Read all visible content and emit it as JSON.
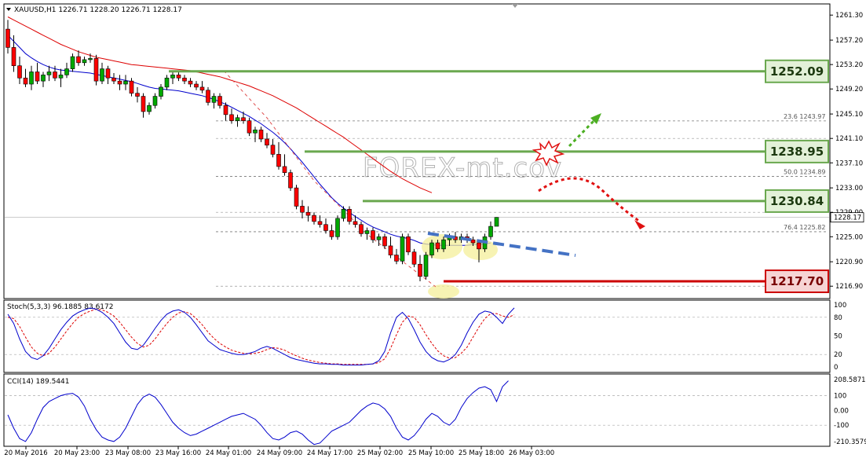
{
  "header": {
    "symbol_line": "XAUUSD,H1  1226.71 1228.20 1226.71 1228.17",
    "stoch_label": "Stoch(5,3,3) 96.1885 83.6172",
    "cci_label": "CCI(14) 189.5441"
  },
  "watermark": "FOREX-mt.cov",
  "colors": {
    "bull": "#00a800",
    "bear": "#ff0000",
    "wick": "#000000",
    "ma_fast": "#0000cc",
    "ma_slow": "#dd0000",
    "resistance": "#6aa84f",
    "support": "#cc0000",
    "trend": "#4472c4",
    "highlight": "#f4ef9a"
  },
  "chart_data": [
    {
      "type": "candlestick",
      "symbol": "XAUUSD",
      "timeframe": "H1",
      "ohlc_last": {
        "open": 1226.71,
        "high": 1228.2,
        "low": 1226.71,
        "close": 1228.17
      },
      "last_price": "1228.17",
      "ylim": [
        1215.0,
        1263.0
      ],
      "y_ticks": [
        "1261.30",
        "1257.20",
        "1253.20",
        "1249.20",
        "1245.10",
        "1241.10",
        "1237.10",
        "1233.00",
        "1229.00",
        "1225.00",
        "1220.90",
        "1216.90"
      ],
      "x_ticks": [
        "20 May 2016",
        "20 May 23:00",
        "23 May 08:00",
        "23 May 16:00",
        "24 May 01:00",
        "24 May 09:00",
        "24 May 17:00",
        "25 May 02:00",
        "25 May 10:00",
        "25 May 18:00",
        "26 May 03:00"
      ],
      "candles": [
        [
          1259.0,
          1260.5,
          1255.0,
          1256.0
        ],
        [
          1256.0,
          1258.0,
          1252.0,
          1253.0
        ],
        [
          1253.0,
          1254.5,
          1250.0,
          1251.0
        ],
        [
          1251.0,
          1252.5,
          1249.5,
          1250.0
        ],
        [
          1250.0,
          1253.0,
          1249.0,
          1252.0
        ],
        [
          1252.0,
          1253.5,
          1250.0,
          1250.5
        ],
        [
          1250.5,
          1252.0,
          1249.5,
          1251.5
        ],
        [
          1251.5,
          1253.0,
          1250.5,
          1252.0
        ],
        [
          1252.0,
          1253.0,
          1250.5,
          1251.0
        ],
        [
          1251.0,
          1252.5,
          1249.5,
          1251.5
        ],
        [
          1251.5,
          1253.5,
          1251.0,
          1252.5
        ],
        [
          1252.5,
          1255.0,
          1252.0,
          1254.5
        ],
        [
          1254.5,
          1255.5,
          1253.0,
          1253.5
        ],
        [
          1253.5,
          1254.5,
          1253.0,
          1254.0
        ],
        [
          1254.0,
          1255.0,
          1253.5,
          1254.2
        ],
        [
          1254.2,
          1254.8,
          1249.8,
          1250.5
        ],
        [
          1250.5,
          1253.5,
          1250.0,
          1252.5
        ],
        [
          1252.5,
          1253.0,
          1250.0,
          1251.0
        ],
        [
          1251.0,
          1251.8,
          1250.0,
          1250.5
        ],
        [
          1250.5,
          1251.5,
          1249.0,
          1250.0
        ],
        [
          1250.0,
          1251.5,
          1249.0,
          1250.5
        ],
        [
          1250.5,
          1251.0,
          1248.0,
          1248.5
        ],
        [
          1248.5,
          1249.5,
          1247.0,
          1248.0
        ],
        [
          1248.0,
          1248.5,
          1244.5,
          1245.5
        ],
        [
          1245.5,
          1247.0,
          1245.0,
          1246.5
        ],
        [
          1246.5,
          1248.5,
          1246.0,
          1248.0
        ],
        [
          1248.0,
          1250.0,
          1247.5,
          1249.5
        ],
        [
          1249.5,
          1251.5,
          1249.0,
          1251.0
        ],
        [
          1251.0,
          1252.0,
          1250.0,
          1251.5
        ],
        [
          1251.5,
          1252.2,
          1250.5,
          1251.0
        ],
        [
          1251.0,
          1251.5,
          1250.0,
          1250.5
        ],
        [
          1250.5,
          1251.0,
          1249.5,
          1250.0
        ],
        [
          1250.0,
          1250.5,
          1249.0,
          1249.5
        ],
        [
          1249.5,
          1250.5,
          1248.5,
          1249.0
        ],
        [
          1249.0,
          1249.5,
          1246.5,
          1247.0
        ],
        [
          1247.0,
          1248.5,
          1246.0,
          1248.0
        ],
        [
          1248.0,
          1248.5,
          1246.0,
          1246.5
        ],
        [
          1246.5,
          1247.0,
          1244.0,
          1245.0
        ],
        [
          1245.0,
          1246.0,
          1243.5,
          1244.0
        ],
        [
          1244.0,
          1245.0,
          1243.0,
          1244.5
        ],
        [
          1244.5,
          1245.5,
          1243.5,
          1244.0
        ],
        [
          1244.0,
          1244.5,
          1241.5,
          1242.0
        ],
        [
          1242.0,
          1243.0,
          1240.5,
          1242.5
        ],
        [
          1242.5,
          1243.0,
          1240.5,
          1241.0
        ],
        [
          1241.0,
          1242.0,
          1239.5,
          1240.0
        ],
        [
          1240.0,
          1241.0,
          1238.0,
          1238.5
        ],
        [
          1238.5,
          1240.5,
          1236.0,
          1236.5
        ],
        [
          1236.5,
          1238.5,
          1235.0,
          1235.5
        ],
        [
          1235.5,
          1236.0,
          1232.5,
          1233.0
        ],
        [
          1233.0,
          1233.5,
          1229.5,
          1230.0
        ],
        [
          1230.0,
          1231.0,
          1228.0,
          1229.0
        ],
        [
          1229.0,
          1230.0,
          1227.5,
          1228.5
        ],
        [
          1228.5,
          1229.0,
          1227.0,
          1227.5
        ],
        [
          1227.5,
          1228.5,
          1226.5,
          1227.0
        ],
        [
          1227.0,
          1228.0,
          1225.5,
          1226.0
        ],
        [
          1226.0,
          1227.0,
          1224.5,
          1225.0
        ],
        [
          1225.0,
          1228.5,
          1224.5,
          1228.0
        ],
        [
          1228.0,
          1230.0,
          1227.5,
          1229.5
        ],
        [
          1229.5,
          1230.0,
          1227.0,
          1227.5
        ],
        [
          1227.5,
          1228.5,
          1226.5,
          1227.0
        ],
        [
          1227.0,
          1227.5,
          1225.0,
          1225.5
        ],
        [
          1225.5,
          1226.5,
          1224.5,
          1226.0
        ],
        [
          1226.0,
          1226.5,
          1224.0,
          1224.5
        ],
        [
          1224.5,
          1225.5,
          1223.5,
          1225.0
        ],
        [
          1225.0,
          1225.5,
          1223.0,
          1223.5
        ],
        [
          1223.5,
          1225.0,
          1221.5,
          1222.0
        ],
        [
          1222.0,
          1223.0,
          1220.5,
          1221.0
        ],
        [
          1221.0,
          1225.5,
          1220.5,
          1225.0
        ],
        [
          1225.0,
          1225.5,
          1222.0,
          1222.5
        ],
        [
          1222.5,
          1223.0,
          1220.0,
          1220.5
        ],
        [
          1220.5,
          1222.0,
          1217.7,
          1218.5
        ],
        [
          1218.5,
          1222.5,
          1218.0,
          1222.0
        ],
        [
          1222.0,
          1224.5,
          1221.5,
          1224.0
        ],
        [
          1224.0,
          1224.5,
          1222.5,
          1223.0
        ],
        [
          1223.0,
          1225.0,
          1222.5,
          1224.5
        ],
        [
          1224.5,
          1225.5,
          1223.5,
          1225.0
        ],
        [
          1225.0,
          1225.8,
          1224.0,
          1224.5
        ],
        [
          1224.5,
          1225.5,
          1224.0,
          1225.0
        ],
        [
          1225.0,
          1225.5,
          1224.0,
          1224.5
        ],
        [
          1224.5,
          1225.0,
          1223.5,
          1224.0
        ],
        [
          1224.0,
          1224.5,
          1220.8,
          1223.0
        ],
        [
          1223.0,
          1225.5,
          1222.5,
          1225.0
        ],
        [
          1225.0,
          1227.5,
          1224.5,
          1226.7
        ],
        [
          1226.71,
          1228.2,
          1226.71,
          1228.17
        ]
      ],
      "ma_fast": [
        1258.0,
        1257.0,
        1256.0,
        1255.0,
        1254.3,
        1253.7,
        1253.2,
        1252.8,
        1252.5,
        1252.3,
        1252.2,
        1252.1,
        1252.0,
        1251.9,
        1251.8,
        1251.6,
        1251.4,
        1251.2,
        1251.0,
        1250.8,
        1250.6,
        1250.4,
        1250.1,
        1249.8,
        1249.5,
        1249.3,
        1249.2,
        1249.1,
        1249.0,
        1248.9,
        1248.7,
        1248.5,
        1248.3,
        1248.1,
        1247.8,
        1247.5,
        1247.1,
        1246.7,
        1246.2,
        1245.7,
        1245.2,
        1244.7,
        1244.1,
        1243.5,
        1242.8,
        1242.1,
        1241.3,
        1240.4,
        1239.4,
        1238.3,
        1237.2,
        1236.0,
        1234.8,
        1233.6,
        1232.5,
        1231.4,
        1230.5,
        1229.7,
        1229.0,
        1228.3,
        1227.7,
        1227.1,
        1226.6,
        1226.2,
        1225.8,
        1225.4,
        1225.1,
        1224.9,
        1224.7,
        1224.4,
        1224.0,
        1223.8,
        1223.7,
        1223.6,
        1223.6,
        1223.6,
        1223.6,
        1223.6,
        1223.6,
        1223.7,
        1223.7,
        1223.8,
        1224.0
      ],
      "ma_slow": [
        1261.0,
        1260.5,
        1260.0,
        1259.5,
        1259.0,
        1258.5,
        1258.0,
        1257.5,
        1257.0,
        1256.5,
        1256.1,
        1255.7,
        1255.3,
        1255.0,
        1254.7,
        1254.4,
        1254.2,
        1254.0,
        1253.8,
        1253.6,
        1253.4,
        1253.2,
        1253.1,
        1253.0,
        1252.9,
        1252.8,
        1252.7,
        1252.6,
        1252.5,
        1252.4,
        1252.3,
        1252.2,
        1252.0,
        1251.8,
        1251.6,
        1251.4,
        1251.2,
        1250.9,
        1250.6,
        1250.3,
        1250.0,
        1249.7,
        1249.3,
        1248.9,
        1248.5,
        1248.1,
        1247.6,
        1247.1,
        1246.6,
        1246.1,
        1245.5,
        1244.9,
        1244.3,
        1243.7,
        1243.1,
        1242.5,
        1241.9,
        1241.3,
        1240.6,
        1239.9,
        1239.2,
        1238.5,
        1237.8,
        1237.1,
        1236.4,
        1235.7,
        1235.1,
        1234.5,
        1234.0,
        1233.5,
        1233.0,
        1232.6,
        1232.2
      ],
      "fib_levels": [
        {
          "label": "23.6",
          "value": 1243.97,
          "text": "1243.97"
        },
        {
          "label": "50.0",
          "value": 1234.89,
          "text": "1234.89"
        },
        {
          "label": "76.4",
          "value": 1225.82,
          "text": "1225.82"
        }
      ],
      "levels": [
        {
          "label": "1252.09",
          "value": 1252.09,
          "kind": "resistance"
        },
        {
          "label": "1238.95",
          "value": 1238.95,
          "kind": "resistance"
        },
        {
          "label": "1230.84",
          "value": 1230.84,
          "kind": "resistance"
        },
        {
          "label": "1217.70",
          "value": 1217.7,
          "kind": "support"
        }
      ],
      "trendline": {
        "from_index": 55,
        "to_index": 96,
        "from_value": 1226.3,
        "to_value": 1223.0
      }
    },
    {
      "type": "line",
      "name": "Stoch(5,3,3)",
      "ylim": [
        0,
        100
      ],
      "y_ticks": [
        "100",
        "80",
        "50",
        "20",
        "0"
      ],
      "main": [
        85,
        70,
        45,
        25,
        15,
        12,
        18,
        30,
        45,
        60,
        72,
        82,
        88,
        92,
        95,
        93,
        88,
        80,
        70,
        55,
        40,
        30,
        28,
        35,
        48,
        62,
        75,
        85,
        90,
        92,
        88,
        80,
        68,
        55,
        42,
        35,
        28,
        25,
        22,
        20,
        20,
        22,
        25,
        30,
        33,
        30,
        25,
        20,
        15,
        12,
        10,
        8,
        6,
        5,
        5,
        4,
        4,
        3,
        3,
        3,
        3,
        4,
        5,
        10,
        25,
        55,
        80,
        88,
        78,
        60,
        40,
        25,
        15,
        10,
        8,
        12,
        20,
        35,
        55,
        72,
        85,
        90,
        88,
        80,
        70,
        85,
        95
      ],
      "signal": [
        80,
        78,
        65,
        48,
        32,
        22,
        18,
        22,
        32,
        45,
        58,
        70,
        80,
        86,
        90,
        93,
        92,
        88,
        82,
        72,
        60,
        48,
        38,
        32,
        35,
        45,
        58,
        70,
        80,
        87,
        89,
        86,
        78,
        68,
        56,
        46,
        38,
        32,
        27,
        24,
        22,
        21,
        22,
        24,
        28,
        31,
        30,
        27,
        22,
        18,
        14,
        11,
        9,
        7,
        6,
        5,
        5,
        4,
        4,
        4,
        4,
        4,
        5,
        7,
        13,
        30,
        52,
        72,
        82,
        80,
        68,
        52,
        38,
        26,
        18,
        14,
        15,
        22,
        32,
        48,
        64,
        78,
        86,
        86,
        82,
        80,
        84
      ]
    },
    {
      "type": "line",
      "name": "CCI(14)",
      "ylim": [
        -260,
        230
      ],
      "y_ticks": [
        "208.5871",
        "100",
        "0.00",
        "-100",
        "-210.3579"
      ],
      "values": [
        -30,
        -120,
        -190,
        -210,
        -150,
        -60,
        20,
        60,
        80,
        100,
        110,
        115,
        90,
        30,
        -60,
        -130,
        -180,
        -200,
        -210,
        -180,
        -120,
        -40,
        40,
        90,
        110,
        90,
        40,
        -20,
        -80,
        -120,
        -150,
        -170,
        -160,
        -140,
        -120,
        -100,
        -80,
        -60,
        -40,
        -30,
        -20,
        -40,
        -60,
        -100,
        -150,
        -190,
        -200,
        -180,
        -150,
        -140,
        -160,
        -200,
        -230,
        -220,
        -180,
        -140,
        -120,
        -100,
        -80,
        -40,
        0,
        30,
        50,
        40,
        10,
        -40,
        -120,
        -180,
        -200,
        -170,
        -120,
        -60,
        -20,
        -40,
        -80,
        -100,
        -60,
        20,
        80,
        120,
        150,
        160,
        140,
        60,
        160,
        200
      ]
    }
  ]
}
